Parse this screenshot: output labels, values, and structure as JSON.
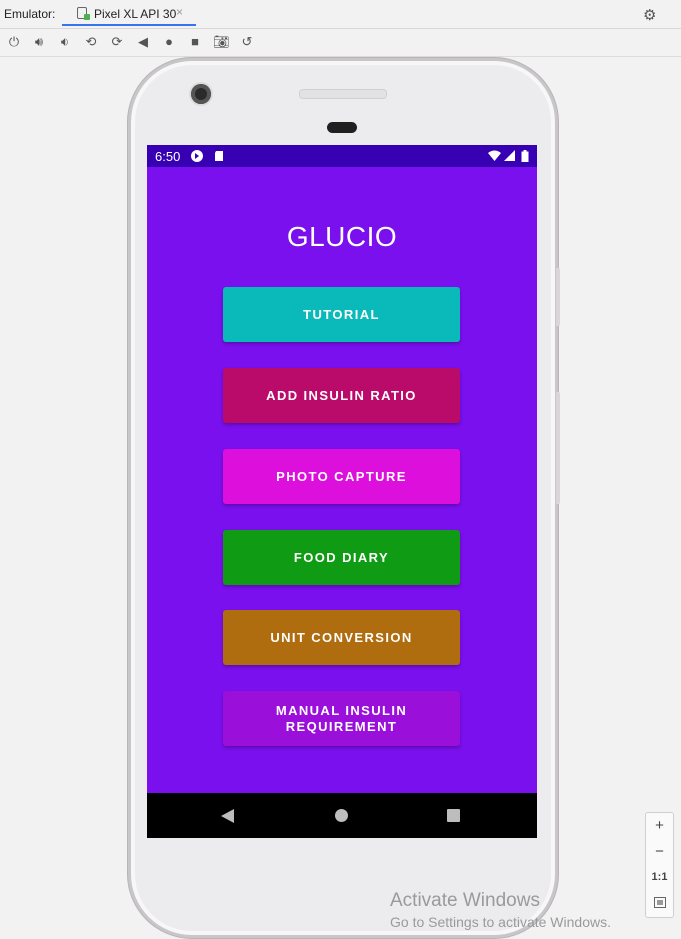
{
  "emulator": {
    "label": "Emulator:",
    "tab_title": "Pixel XL API 30",
    "tab_close": "×",
    "toolbar_icons": [
      "power-icon",
      "volume-up-icon",
      "volume-down-icon",
      "rotate-left-icon",
      "rotate-right-icon",
      "back-icon",
      "home-icon",
      "overview-icon",
      "camera-icon",
      "snapshot-icon"
    ]
  },
  "status_bar": {
    "time": "6:50"
  },
  "app": {
    "title": "GLUCIO",
    "buttons": [
      {
        "label": "TUTORIAL",
        "color": "#0ababa"
      },
      {
        "label": "ADD INSULIN RATIO",
        "color": "#ba0b6a"
      },
      {
        "label": "PHOTO CAPTURE",
        "color": "#dc0fdc"
      },
      {
        "label": "FOOD DIARY",
        "color": "#0f9b14"
      },
      {
        "label": "UNIT CONVERSION",
        "color": "#b06d10"
      },
      {
        "label": "MANUAL INSULIN REQUIREMENT",
        "color": "#9a0fda"
      }
    ],
    "background": "#7a10ee",
    "status_bar_color": "#3700b3"
  },
  "zoom_controls": {
    "zoom_in": "+",
    "zoom_out": "−",
    "actual_size": "1:1"
  },
  "watermark": {
    "line1": "Activate Windows",
    "line2": "Go to Settings to activate Windows."
  }
}
